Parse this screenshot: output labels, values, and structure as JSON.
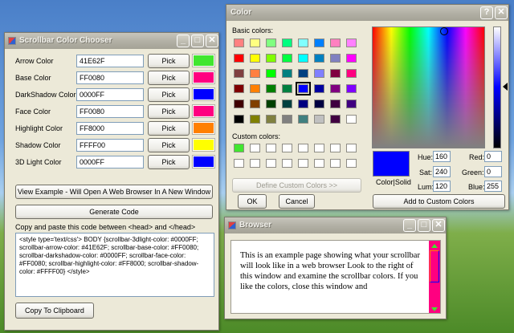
{
  "chooser": {
    "title": "Scrollbar Color Chooser",
    "rows": [
      {
        "label": "Arrow Color",
        "value": "41E62F",
        "color": "#41E62F"
      },
      {
        "label": "Base Color",
        "value": "FF0080",
        "color": "#FF0080"
      },
      {
        "label": "DarkShadow Color",
        "value": "0000FF",
        "color": "#0000FF"
      },
      {
        "label": "Face Color",
        "value": "FF0080",
        "color": "#FF0080"
      },
      {
        "label": "Highlight Color",
        "value": "FF8000",
        "color": "#FF8000"
      },
      {
        "label": "Shadow Color",
        "value": "FFFF00",
        "color": "#FFFF00"
      },
      {
        "label": "3D Light Color",
        "value": "0000FF",
        "color": "#0000FF"
      }
    ],
    "pick_label": "Pick",
    "view_example_label": "View Example - Will Open A Web Browser In A New Window",
    "generate_label": "Generate Code",
    "copy_instructions": "Copy and paste this code between <head> and </head>",
    "code": "<style type='text/css'> BODY {scrollbar-3dlight-color: #0000FF; scrollbar-arrow-color: #41E62F; scrollbar-base-color: #FF0080; scrollbar-darkshadow-color: #0000FF; scrollbar-face-color: #FF0080; scrollbar-highlight-color: #FF8000; scrollbar-shadow-color: #FFFF00} </style>",
    "copy_label": "Copy To Clipboard"
  },
  "color_dialog": {
    "title": "Color",
    "basic_label": "Basic colors:",
    "custom_label": "Custom colors:",
    "define_label": "Define Custom Colors >>",
    "ok_label": "OK",
    "cancel_label": "Cancel",
    "add_label": "Add to Custom Colors",
    "colorsolid_label": "Color|Solid",
    "selected_color": "#0000FF",
    "hue_label": "Hue:",
    "hue": "160",
    "sat_label": "Sat:",
    "sat": "240",
    "lum_label": "Lum:",
    "lum": "120",
    "red_label": "Red:",
    "red": "0",
    "green_label": "Green:",
    "green": "0",
    "blue_label": "Blue:",
    "blue": "255",
    "basic_colors": [
      "#FF8080",
      "#FFFF80",
      "#80FF80",
      "#00FF80",
      "#80FFFF",
      "#0080FF",
      "#FF80C0",
      "#FF80FF",
      "#FF0000",
      "#FFFF00",
      "#80FF00",
      "#00FF40",
      "#00FFFF",
      "#0080C0",
      "#8080C0",
      "#FF00FF",
      "#804040",
      "#FF8040",
      "#00FF00",
      "#008080",
      "#004080",
      "#8080FF",
      "#800040",
      "#FF0080",
      "#800000",
      "#FF8000",
      "#008000",
      "#008040",
      "#0000FF",
      "#0000A0",
      "#800080",
      "#8000FF",
      "#400000",
      "#804000",
      "#004000",
      "#004040",
      "#000080",
      "#000040",
      "#400040",
      "#400080",
      "#000000",
      "#808000",
      "#808040",
      "#808080",
      "#408080",
      "#C0C0C0",
      "#400040",
      "#FFFFFF"
    ],
    "selected_basic_index": 28,
    "custom_colors": [
      "#41E62F",
      "#FFFFFF",
      "#FFFFFF",
      "#FFFFFF",
      "#FFFFFF",
      "#FFFFFF",
      "#FFFFFF",
      "#FFFFFF",
      "#FFFFFF",
      "#FFFFFF",
      "#FFFFFF",
      "#FFFFFF",
      "#FFFFFF",
      "#FFFFFF",
      "#FFFFFF",
      "#FFFFFF"
    ]
  },
  "browser": {
    "title": "Browser",
    "text": "This is an example page showing what your scrollbar will look like in a web browser Look to the right of this window and examine the scrollbar colors. If you like the colors, close this window and",
    "scroll_face": "#FF0080",
    "scroll_arrow": "#41E62F"
  }
}
